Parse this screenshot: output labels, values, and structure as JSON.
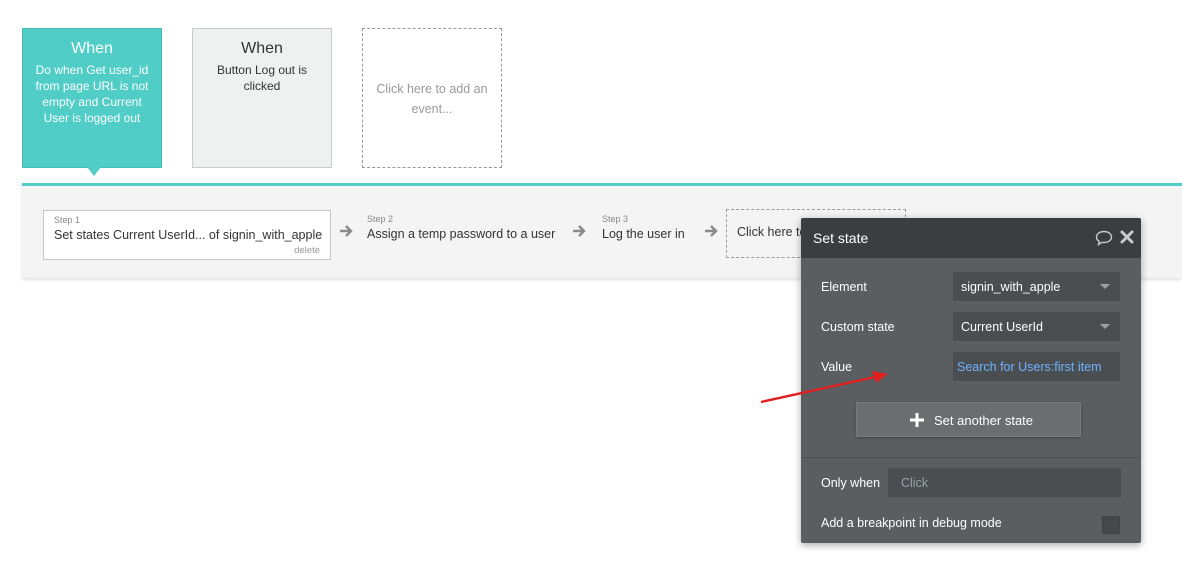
{
  "events": [
    {
      "title": "When",
      "description": "Do when Get user_id from page URL is not empty and Current User is logged out"
    },
    {
      "title": "When",
      "description": "Button Log out is clicked"
    },
    {
      "add_label": "Click here to add an event..."
    }
  ],
  "steps": [
    {
      "label": "Step 1",
      "text": "Set states Current UserId... of signin_with_apple",
      "delete_label": "delete"
    },
    {
      "label": "Step 2",
      "text": "Assign a temp password to a user"
    },
    {
      "label": "Step 3",
      "text": "Log the user in"
    }
  ],
  "add_step_label": "Click here to",
  "panel": {
    "title": "Set state",
    "element_label": "Element",
    "element_value": "signin_with_apple",
    "custom_state_label": "Custom state",
    "custom_state_value": "Current UserId",
    "value_label": "Value",
    "value_expression": "Search for Users:first item",
    "another_state_label": "Set another state",
    "only_when_label": "Only when",
    "only_when_placeholder": "Click",
    "breakpoint_label": "Add a breakpoint in debug mode"
  },
  "colors": {
    "accent": "#4fcdc6",
    "panel_bg": "#5a5e61",
    "panel_header": "#3a3e40",
    "expression": "#6fb3ff",
    "annotation_arrow": "#e02020"
  }
}
